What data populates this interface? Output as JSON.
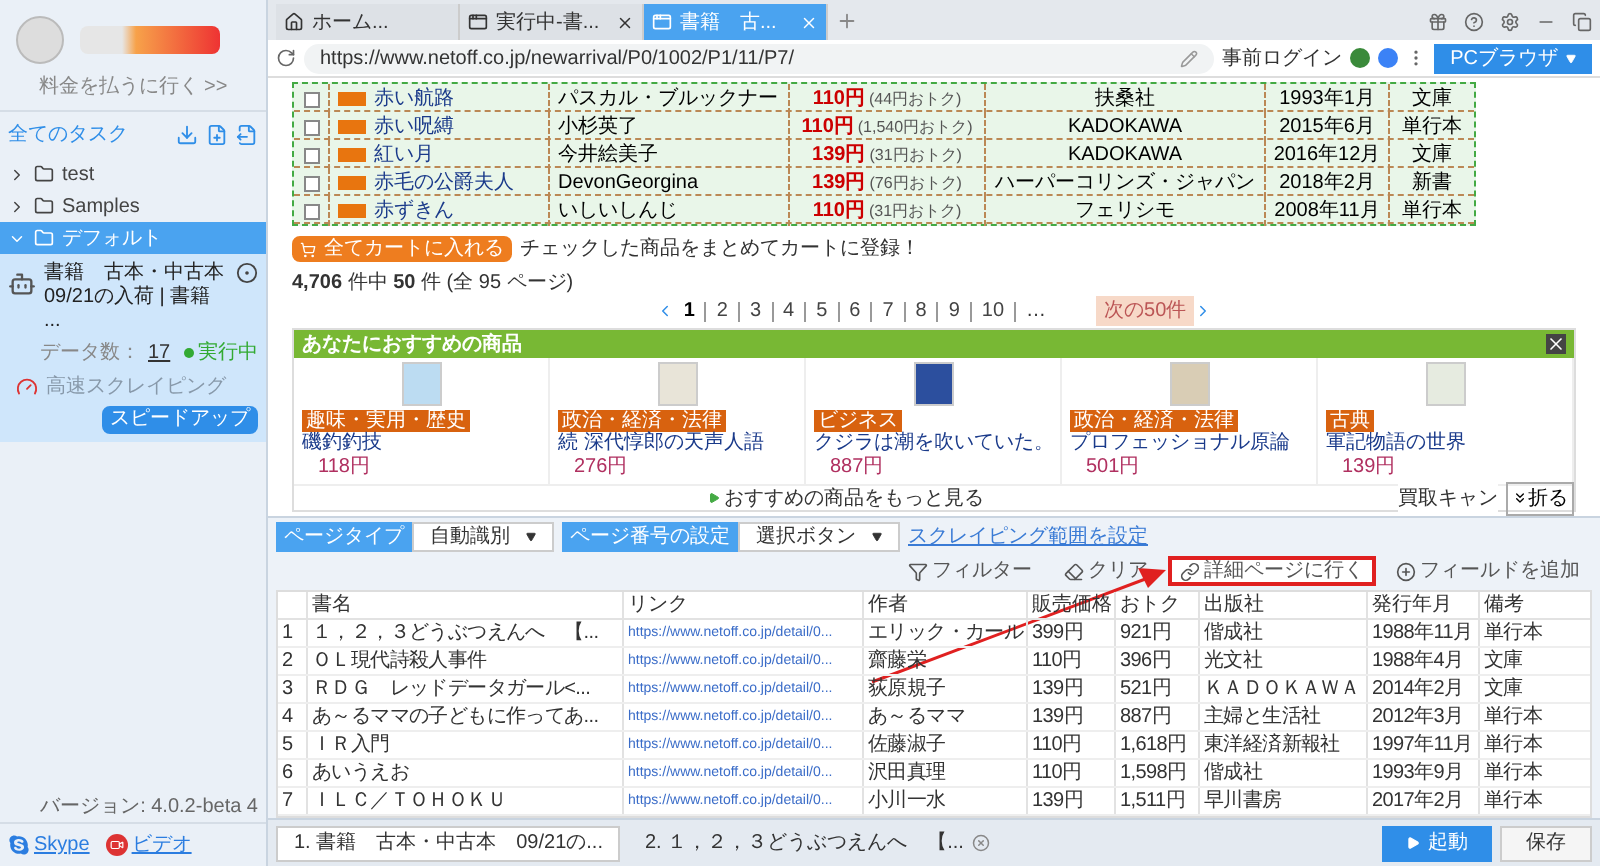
{
  "sidebar": {
    "pay_link": "料金を払うに行く >>",
    "all_tasks": "全てのタスク",
    "tree": [
      {
        "label": "test",
        "expanded": false,
        "selected": false
      },
      {
        "label": "Samples",
        "expanded": false,
        "selected": false
      },
      {
        "label": "デフォルト",
        "expanded": true,
        "selected": true,
        "children": [
          {
            "title": "書籍　古本・中古本　09/21の入荷 | 書籍 ...",
            "data_label": "データ数：",
            "data_count": "17",
            "status": "実行中",
            "mode": "高速スクレイピング",
            "action": "スピードアップ"
          }
        ]
      }
    ],
    "footer": {
      "links": [
        "Skype",
        "ビデオ"
      ],
      "version": "バージョン: 4.0.2-beta 4"
    }
  },
  "browser": {
    "tabs": [
      {
        "label": "ホーム...",
        "kind": "home",
        "selected": false,
        "closable": false
      },
      {
        "label": "実行中-書...",
        "kind": "page",
        "selected": false,
        "closable": true
      },
      {
        "label": "書籍　古...",
        "kind": "page",
        "selected": true,
        "closable": true
      }
    ],
    "url": "https://www.netoff.co.jp/newarrival/P0/1002/P1/11/P7/",
    "login": "事前ログイン",
    "mode_button": "PCブラウザ"
  },
  "page": {
    "products": [
      {
        "checked": false,
        "title": "赤い航路",
        "author": "パスカル・ブルックナー",
        "price": "110円",
        "discount": "(44円おトク)",
        "publisher": "扶桑社",
        "date": "1993年1月",
        "format": "文庫"
      },
      {
        "checked": false,
        "title": "赤い呪縛",
        "author": "小杉英了",
        "price": "110円",
        "discount": "(1,540円おトク)",
        "publisher": "KADOKAWA",
        "date": "2015年6月",
        "format": "単行本"
      },
      {
        "checked": false,
        "title": "紅い月",
        "author": "今井絵美子",
        "price": "139円",
        "discount": "(31円おトク)",
        "publisher": "KADOKAWA",
        "date": "2016年12月",
        "format": "文庫"
      },
      {
        "checked": false,
        "title": "赤毛の公爵夫人",
        "author": "DevonGeorgina",
        "price": "139円",
        "discount": "(76円おトク)",
        "publisher": "ハーパーコリンズ・ジャパン",
        "date": "2018年2月",
        "format": "新書"
      },
      {
        "checked": false,
        "title": "赤ずきん",
        "author": "いしいしんじ",
        "price": "110円",
        "discount": "(31円おトク)",
        "publisher": "フェリシモ",
        "date": "2008年11月",
        "format": "単行本"
      }
    ],
    "cart_button": "全てカートに入れる",
    "cart_note": "チェックした商品をまとめてカートに登録！",
    "count": "**4,706** 件中 **50** 件 (全 95 ページ)",
    "pagination": {
      "pages": [
        {
          "label": "1",
          "selected": true
        },
        {
          "label": "2",
          "selected": false
        },
        {
          "label": "3",
          "selected": false
        },
        {
          "label": "4",
          "selected": false
        },
        {
          "label": "5",
          "selected": false
        },
        {
          "label": "6",
          "selected": false
        },
        {
          "label": "7",
          "selected": false
        },
        {
          "label": "8",
          "selected": false
        },
        {
          "label": "9",
          "selected": false
        },
        {
          "label": "10",
          "selected": false
        }
      ],
      "ellipsis": "…",
      "next": "次の50件"
    },
    "recommend": {
      "title": "あなたにおすすめの商品",
      "items": [
        {
          "category": "趣味・実用・歴史",
          "title": "磯釣釣技",
          "price": "118円"
        },
        {
          "category": "政治・経済・法律",
          "title": "続 深代惇郎の天声人語",
          "price": "276円"
        },
        {
          "category": "ビジネス",
          "title": "クジラは潮を吹いていた。",
          "price": "887円"
        },
        {
          "category": "政治・経済・法律",
          "title": "プロフェッショナル原論",
          "price": "501円"
        },
        {
          "category": "古典",
          "title": "軍記物語の世界",
          "price": "139円"
        }
      ],
      "more": "おすすめの商品をもっと見る"
    },
    "overlay": {
      "banner": "買取キャン",
      "fold": "折る"
    }
  },
  "panel": {
    "page_type": {
      "label": "ページタイプ",
      "value": "自動識別"
    },
    "page_number": {
      "label": "ページ番号の設定",
      "value": "選択ボタン"
    },
    "range_link": "スクレイピング範囲を設定",
    "actions": [
      {
        "label": "フィルター",
        "kind": "filter",
        "highlighted": false
      },
      {
        "label": "クリア",
        "kind": "clear",
        "highlighted": false
      },
      {
        "label": "詳細ページに行く",
        "kind": "link",
        "highlighted": true
      },
      {
        "label": "フィールドを追加",
        "kind": "add",
        "highlighted": false
      }
    ],
    "table": {
      "columns": [
        "書名",
        "リンク",
        "作者",
        "販売価格",
        "おトク",
        "出版社",
        "発行年月",
        "備考"
      ],
      "rows": [
        {
          "index": "1",
          "cells": [
            "１，２，３どうぶつえんへ　【...",
            "https://www.netoff.co.jp/detail/0...",
            "エリック・カール",
            "399円",
            "921円",
            "偕成社",
            "1988年11月",
            "単行本"
          ]
        },
        {
          "index": "2",
          "cells": [
            "ＯＬ現代詩殺人事件",
            "https://www.netoff.co.jp/detail/0...",
            "齋藤栄",
            "110円",
            "396円",
            "光文社",
            "1988年4月",
            "文庫"
          ]
        },
        {
          "index": "3",
          "cells": [
            "ＲＤＧ　レッドデータガール<...",
            "https://www.netoff.co.jp/detail/0...",
            "荻原規子",
            "139円",
            "521円",
            "ＫＡＤＯＫＡＷＡ",
            "2014年2月",
            "文庫"
          ]
        },
        {
          "index": "4",
          "cells": [
            "あ～るママの子どもに作ってあ...",
            "https://www.netoff.co.jp/detail/0...",
            "あ～るママ",
            "139円",
            "887円",
            "主婦と生活社",
            "2012年3月",
            "単行本"
          ]
        },
        {
          "index": "5",
          "cells": [
            "ＩＲ入門",
            "https://www.netoff.co.jp/detail/0...",
            "佐藤淑子",
            "110円",
            "1,618円",
            "東洋経済新報社",
            "1997年11月",
            "単行本"
          ]
        },
        {
          "index": "6",
          "cells": [
            "あいうえお",
            "https://www.netoff.co.jp/detail/0...",
            "沢田真理",
            "110円",
            "1,598円",
            "偕成社",
            "1993年9月",
            "単行本"
          ]
        },
        {
          "index": "7",
          "cells": [
            "ＩＬＣ／ＴＯＨＯＫＵ",
            "https://www.netoff.co.jp/detail/0...",
            "小川一水",
            "139円",
            "1,511円",
            "早川書房",
            "2017年2月",
            "単行本"
          ]
        }
      ]
    }
  },
  "bottom": {
    "tabs": [
      {
        "label": "1. 書籍　古本・中古本　09/21の...",
        "selected": true,
        "closable": false
      },
      {
        "label": "2. １，２，３どうぶつえんへ　【...",
        "selected": false,
        "closable": true
      }
    ],
    "start": "起動",
    "save": "保存"
  }
}
